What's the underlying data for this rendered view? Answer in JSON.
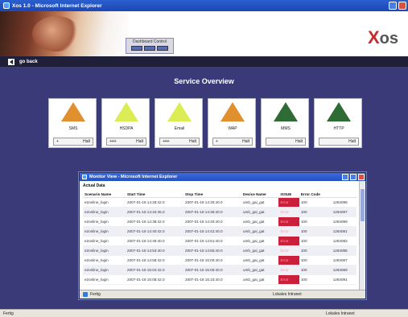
{
  "browser": {
    "title": "Xos 1.0 - Microsoft Internet Explorer",
    "status": "Fertig",
    "zone": "Lokales Intranet"
  },
  "header": {
    "dashboard_label": "Dashboard Control",
    "logo_x": "X",
    "logo_os": "os"
  },
  "nav": {
    "back_label": "go back"
  },
  "page_title": "Service Overview",
  "services": [
    {
      "name": "SMS",
      "color": "#e0902f",
      "dots": "+",
      "status": "Halt"
    },
    {
      "name": "HSDPA",
      "color": "#dcec55",
      "dots": "++++",
      "status": "Halt"
    },
    {
      "name": "Email",
      "color": "#dcec55",
      "dots": "++++",
      "status": "Halt"
    },
    {
      "name": "WAP",
      "color": "#e0902f",
      "dots": "+",
      "status": "Halt"
    },
    {
      "name": "MMS",
      "color": "#2f6b34",
      "dots": "",
      "status": "Halt"
    },
    {
      "name": "HTTP",
      "color": "#2f6b34",
      "dots": "",
      "status": "Halt"
    }
  ],
  "monitor": {
    "title": "Monitor View - Microsoft Internet Explorer",
    "section": "Actual Data",
    "columns": [
      "Scenario Name",
      "Start Time",
      "Stop Time",
      "Device Name",
      "ISSUE",
      "Error Code",
      ""
    ],
    "rows": [
      [
        "e2online_login",
        "2007-01-18 14:28:42.0",
        "2007-01-18 14:30:40.0",
        "umb_gai_gat",
        "Error",
        "100",
        "1284095"
      ],
      [
        "e2online_login",
        "2007-01-18 14:34:45.0",
        "2007-01-18 14:36:40.0",
        "umb_gai_gat",
        "Error",
        "100",
        "1284097"
      ],
      [
        "e2online_login",
        "2007-01-18 14:38:42.0",
        "2007-01-18 14:40:40.0",
        "umb_gai_gat",
        "Error",
        "100",
        "1284099"
      ],
      [
        "e2online_login",
        "2007-01-18 14:40:42.0",
        "2007-01-18 14:42:40.0",
        "umb_gai_gat",
        "Error",
        "100",
        "1284081"
      ],
      [
        "e2online_login",
        "2007-01-18 14:49:40.0",
        "2007-01-18 14:51:40.0",
        "umb_gai_gat",
        "Error",
        "100",
        "1284083"
      ],
      [
        "e2online_login",
        "2007-01-18 14:53:40.0",
        "2007-01-18 14:55:40.0",
        "umb_gai_gat",
        "Error",
        "100",
        "1284085"
      ],
      [
        "e2online_login",
        "2007-01-18 14:58:42.0",
        "2007-01-18 15:00:40.0",
        "umb_gai_gat",
        "Error",
        "100",
        "1284087"
      ],
      [
        "e2online_login",
        "2007-01-18 15:04:42.0",
        "2007-01-18 15:06:40.0",
        "umb_gai_gat",
        "Error",
        "100",
        "1284089"
      ],
      [
        "e2online_login",
        "2007-01-18 15:08:42.0",
        "2007-01-18 15:10:40.0",
        "umb_gai_gat",
        "Error",
        "100",
        "1284091"
      ]
    ],
    "status": "Fertig",
    "zone": "Lokales Intranet"
  }
}
